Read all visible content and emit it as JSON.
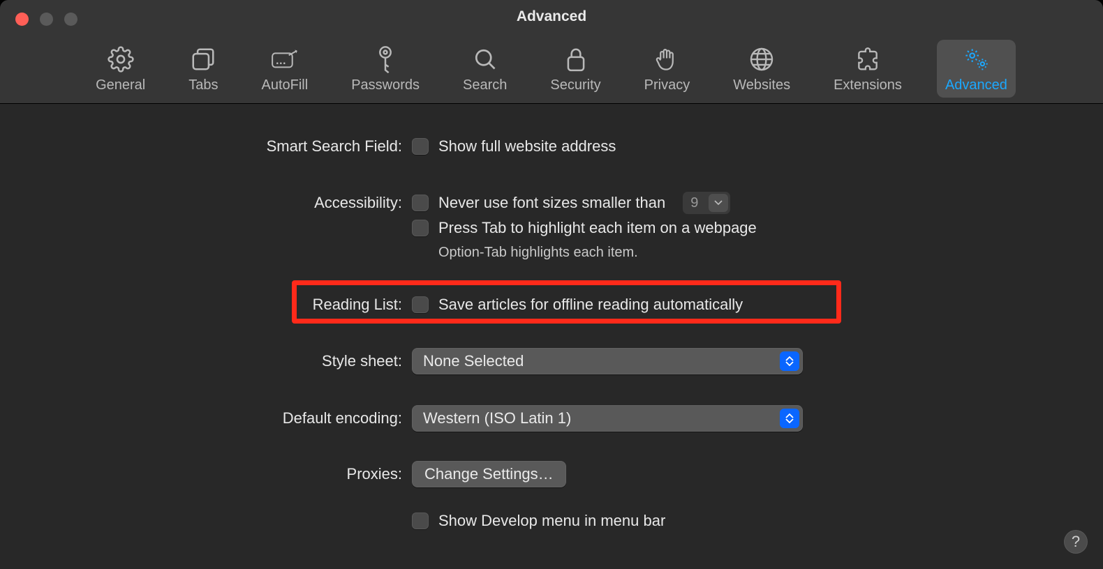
{
  "window": {
    "title": "Advanced"
  },
  "tabs": [
    {
      "label": "General"
    },
    {
      "label": "Tabs"
    },
    {
      "label": "AutoFill"
    },
    {
      "label": "Passwords"
    },
    {
      "label": "Search"
    },
    {
      "label": "Security"
    },
    {
      "label": "Privacy"
    },
    {
      "label": "Websites"
    },
    {
      "label": "Extensions"
    },
    {
      "label": "Advanced"
    }
  ],
  "sections": {
    "smart_search": {
      "label": "Smart Search Field:",
      "show_full_address": "Show full website address"
    },
    "accessibility": {
      "label": "Accessibility:",
      "never_font_smaller": "Never use font sizes smaller than",
      "font_size_value": "9",
      "press_tab": "Press Tab to highlight each item on a webpage",
      "option_tab_hint": "Option-Tab highlights each item."
    },
    "reading_list": {
      "label": "Reading List:",
      "save_offline": "Save articles for offline reading automatically"
    },
    "style_sheet": {
      "label": "Style sheet:",
      "value": "None Selected"
    },
    "default_encoding": {
      "label": "Default encoding:",
      "value": "Western (ISO Latin 1)"
    },
    "proxies": {
      "label": "Proxies:",
      "button": "Change Settings…"
    },
    "develop": {
      "show_develop": "Show Develop menu in menu bar"
    }
  }
}
